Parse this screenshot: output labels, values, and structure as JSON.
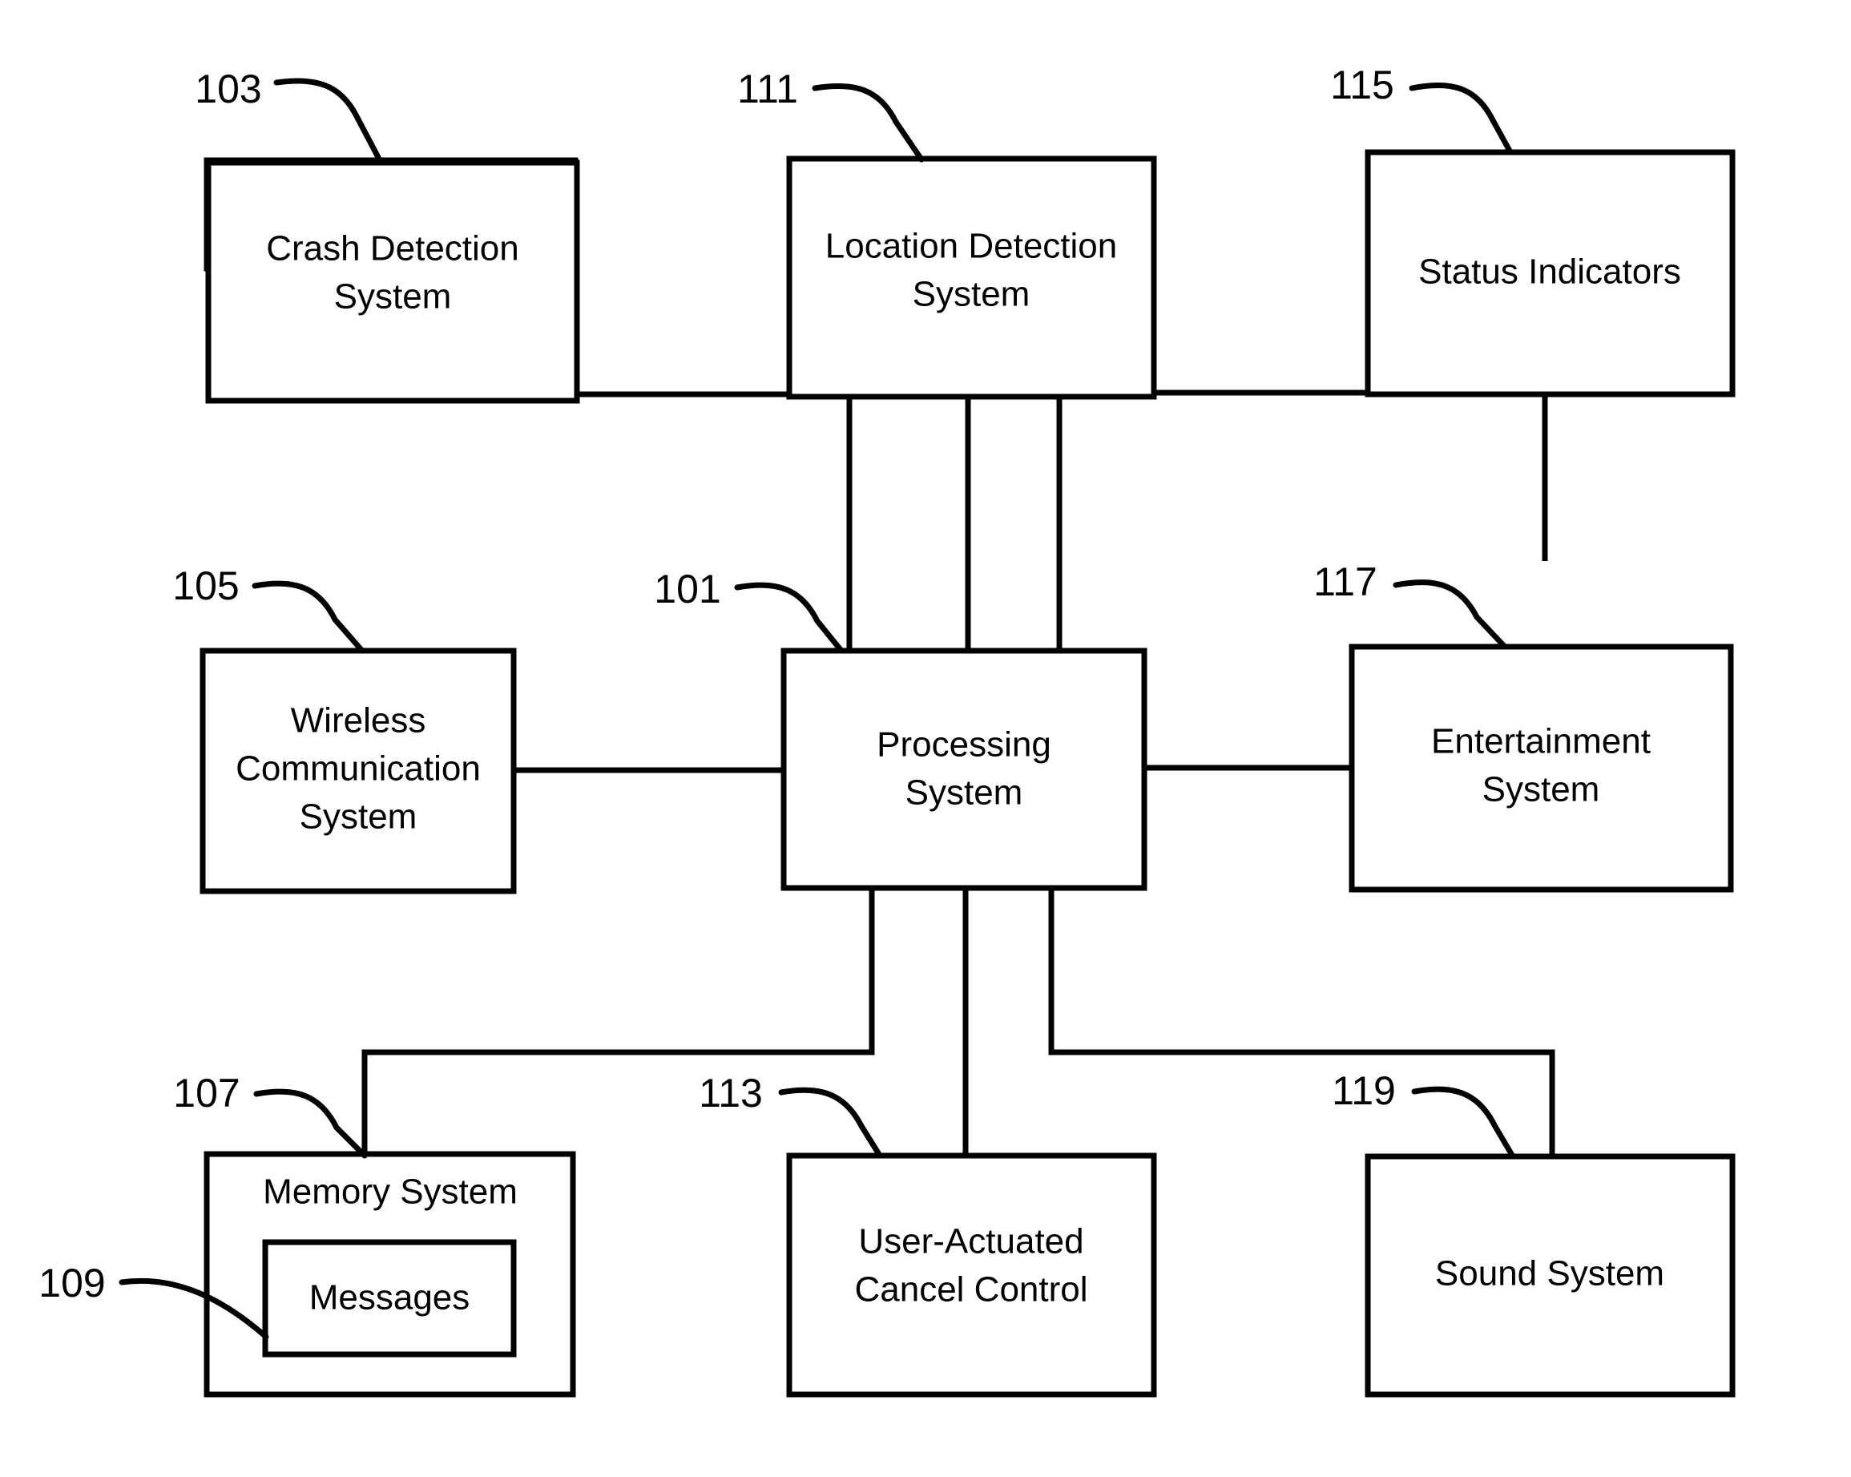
{
  "figure": {
    "type": "patent-block-diagram",
    "background_color": "#ffffff",
    "line_color": "#000000"
  },
  "blocks": {
    "crash_detection": {
      "ref": "103",
      "line1": "Crash Detection",
      "line2": "System"
    },
    "location_detection": {
      "ref": "111",
      "line1": "Location Detection",
      "line2": "System"
    },
    "status_indicators": {
      "ref": "115",
      "line1": "Status Indicators",
      "line2": ""
    },
    "wireless_communication": {
      "ref": "105",
      "line1": "Wireless",
      "line2": "Communication",
      "line3": "System"
    },
    "processing": {
      "ref": "101",
      "line1": "Processing",
      "line2": "System"
    },
    "entertainment": {
      "ref": "117",
      "line1": "Entertainment",
      "line2": "System"
    },
    "memory": {
      "ref": "107",
      "line1": "Memory System",
      "inner": {
        "ref": "109",
        "label": "Messages"
      }
    },
    "cancel_control": {
      "ref": "113",
      "line1": "User-Actuated",
      "line2": "Cancel Control"
    },
    "sound": {
      "ref": "119",
      "line1": "Sound System",
      "line2": ""
    }
  }
}
